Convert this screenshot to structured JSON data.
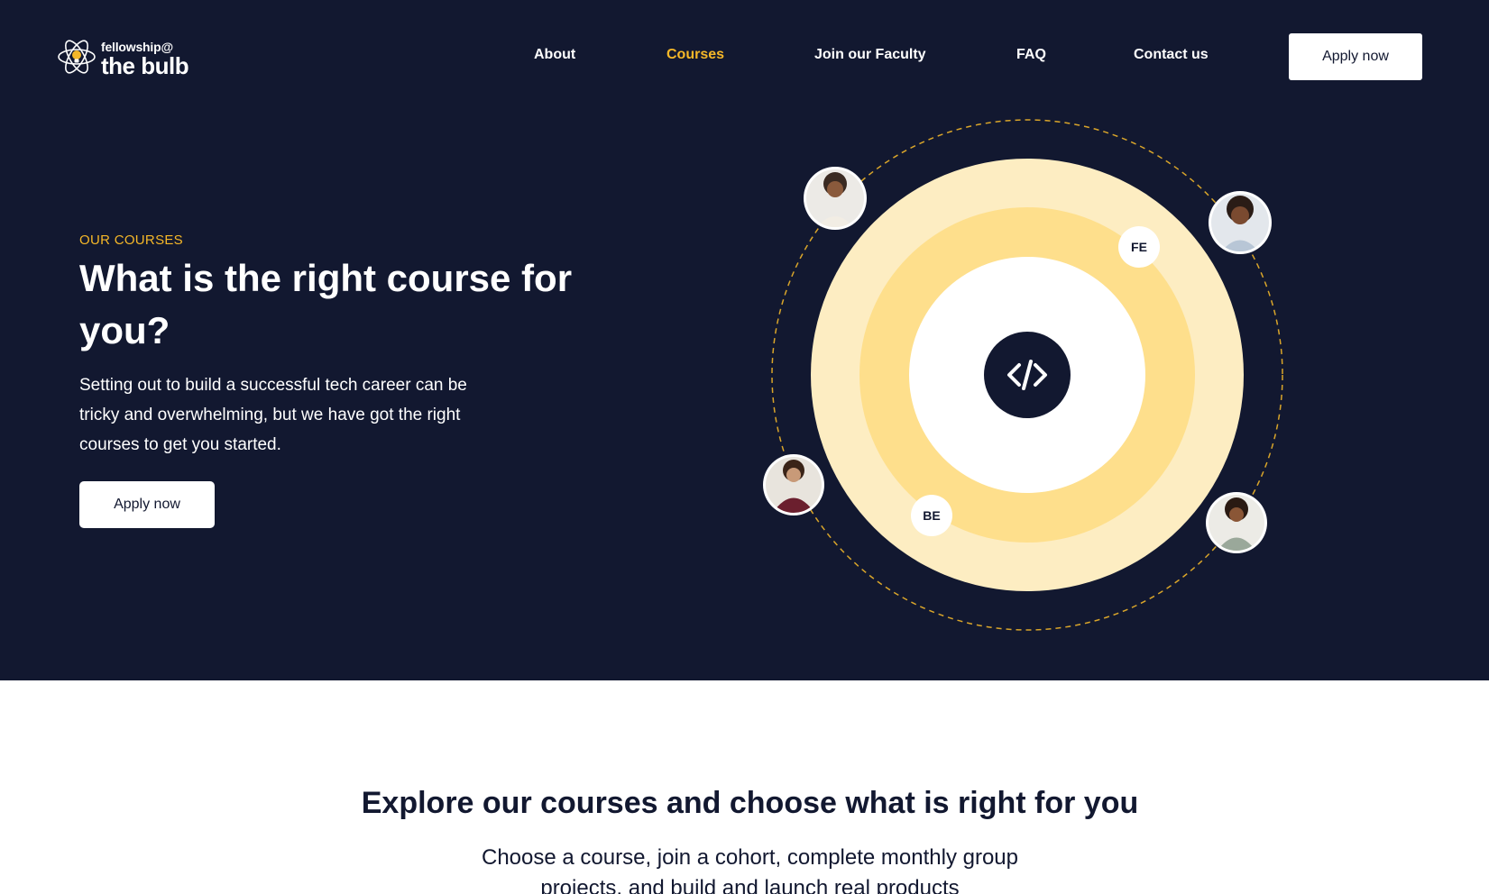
{
  "brand": {
    "small_text": "fellowship@",
    "big_text": "the bulb",
    "logo_icon": "bulb-atom-icon"
  },
  "nav": {
    "items": [
      {
        "label": "About",
        "active": false
      },
      {
        "label": "Courses",
        "active": true
      },
      {
        "label": "Join our Faculty",
        "active": false
      },
      {
        "label": "FAQ",
        "active": false
      },
      {
        "label": "Contact us",
        "active": false
      }
    ],
    "apply_label": "Apply now"
  },
  "hero": {
    "eyebrow": "OUR COURSES",
    "title": "What is the right course for you?",
    "description": "Setting out to build a successful tech career can be tricky and overwhelming, but we have got the right courses to get you started.",
    "apply_label": "Apply now"
  },
  "illustration": {
    "center_icon": "code-icon",
    "badges": [
      "FE",
      "BE"
    ],
    "avatars": [
      "avatar-top-left",
      "avatar-top-right",
      "avatar-bottom-left",
      "avatar-bottom-right"
    ]
  },
  "explore": {
    "title": "Explore our courses and choose what is right for you",
    "description": "Choose a course, join a cohort, complete monthly group projects, and build and launch real products"
  },
  "colors": {
    "background_dark": "#121830",
    "accent": "#f5b728",
    "ring_outer": "#fdedc2",
    "ring_middle": "#fedf8c",
    "white": "#ffffff"
  }
}
